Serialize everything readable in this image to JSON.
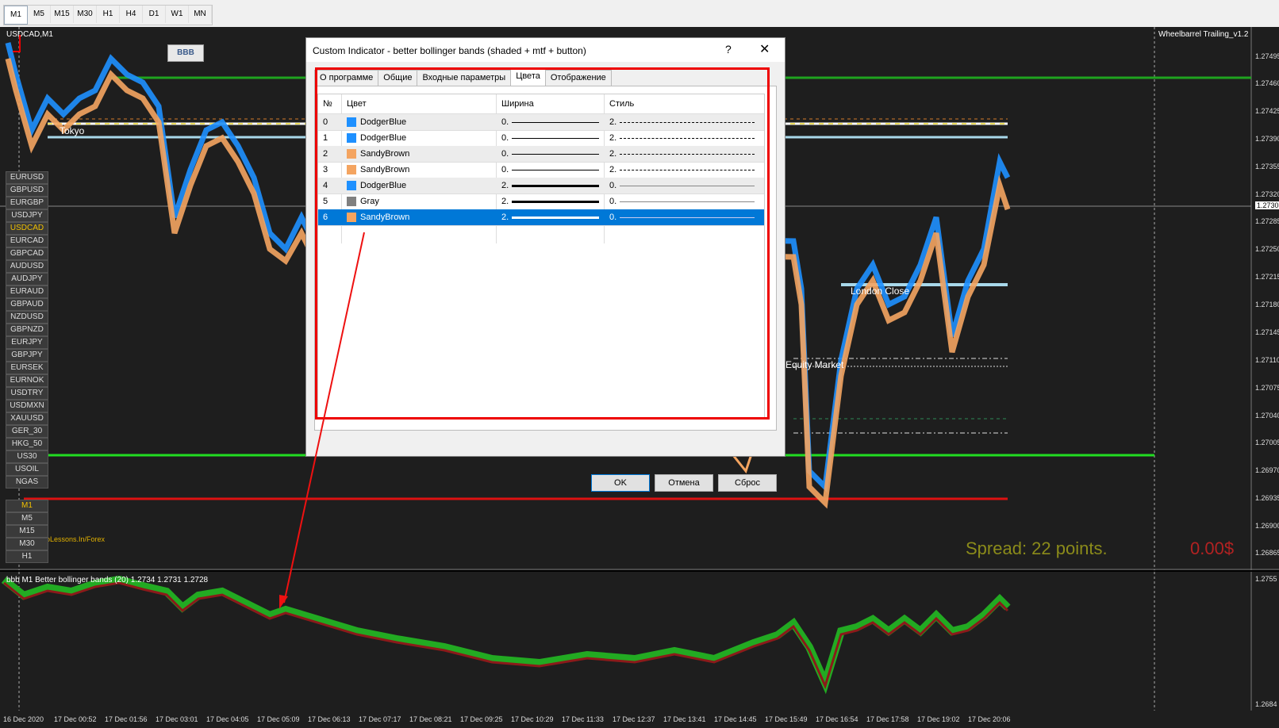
{
  "toolbar": {
    "timeframes": [
      "M1",
      "M5",
      "M15",
      "M30",
      "H1",
      "H4",
      "D1",
      "W1",
      "MN"
    ],
    "active_timeframe": "M1"
  },
  "chart": {
    "symbol_label": "USDCAD,M1",
    "top_right_label": "Wheelbarrel Trailing_v1.2",
    "bbb_button": "BBB",
    "session_tokyo": "Tokyo",
    "session_london": "London Close",
    "equity_market": "Equity Market",
    "watermark": "oLessons.In/Forex",
    "spread_text": "Spread: 22 points.",
    "profit_text": "0.00$",
    "price_labels": [
      "1.27495",
      "1.27460",
      "1.27425",
      "1.27390",
      "1.27355",
      "1.27320",
      "1.27303",
      "1.27285",
      "1.27250",
      "1.27215",
      "1.27180",
      "1.27145",
      "1.27110",
      "1.27075",
      "1.27040",
      "1.27005",
      "1.26970",
      "1.26935",
      "1.26900",
      "1.26865"
    ],
    "current_price": "1.27303",
    "symbols": [
      "EURUSD",
      "GBPUSD",
      "EURGBP",
      "USDJPY",
      "USDCAD",
      "EURCAD",
      "GBPCAD",
      "AUDUSD",
      "AUDJPY",
      "EURAUD",
      "GBPAUD",
      "NZDUSD",
      "GBPNZD",
      "EURJPY",
      "GBPJPY",
      "EURSEK",
      "EURNOK",
      "USDTRY",
      "USDMXN",
      "XAUUSD",
      "GER_30",
      "HKG_50",
      "US30",
      "USOIL",
      "NGAS"
    ],
    "highlighted_symbol": "USDCAD",
    "tf_buttons": [
      "M1",
      "M5",
      "M15",
      "M30",
      "H1"
    ],
    "highlighted_tf": "M1"
  },
  "subchart": {
    "label": "bbb M1 Better bollinger bands (20) 1.2734 1.2731 1.2728",
    "price_top": "1.2755",
    "price_bottom": "1.2684"
  },
  "time_axis": [
    "16 Dec 2020",
    "17 Dec 00:52",
    "17 Dec 01:56",
    "17 Dec 03:01",
    "17 Dec 04:05",
    "17 Dec 05:09",
    "17 Dec 06:13",
    "17 Dec 07:17",
    "17 Dec 08:21",
    "17 Dec 09:25",
    "17 Dec 10:29",
    "17 Dec 11:33",
    "17 Dec 12:37",
    "17 Dec 13:41",
    "17 Dec 14:45",
    "17 Dec 15:49",
    "17 Dec 16:54",
    "17 Dec 17:58",
    "17 Dec 19:02",
    "17 Dec 20:06"
  ],
  "dialog": {
    "title": "Custom Indicator - better bollinger bands (shaded + mtf + button)",
    "help": "?",
    "close": "✕",
    "tabs": [
      "О программе",
      "Общие",
      "Входные параметры",
      "Цвета",
      "Отображение"
    ],
    "active_tab": "Цвета",
    "columns": [
      "№",
      "Цвет",
      "Ширина",
      "Стиль"
    ],
    "rows": [
      {
        "n": "0",
        "color": "DodgerBlue",
        "hex": "#1e90ff",
        "width": "0.",
        "style": "2."
      },
      {
        "n": "1",
        "color": "DodgerBlue",
        "hex": "#1e90ff",
        "width": "0.",
        "style": "2."
      },
      {
        "n": "2",
        "color": "SandyBrown",
        "hex": "#f4a460",
        "width": "0.",
        "style": "2."
      },
      {
        "n": "3",
        "color": "SandyBrown",
        "hex": "#f4a460",
        "width": "0.",
        "style": "2."
      },
      {
        "n": "4",
        "color": "DodgerBlue",
        "hex": "#1e90ff",
        "width": "2.",
        "style": "0."
      },
      {
        "n": "5",
        "color": "Gray",
        "hex": "#808080",
        "width": "2.",
        "style": "0."
      },
      {
        "n": "6",
        "color": "SandyBrown",
        "hex": "#f4a460",
        "width": "2.",
        "style": "0."
      }
    ],
    "selected_row": "6",
    "buttons": {
      "ok": "OK",
      "cancel": "Отмена",
      "reset": "Сброс"
    }
  }
}
